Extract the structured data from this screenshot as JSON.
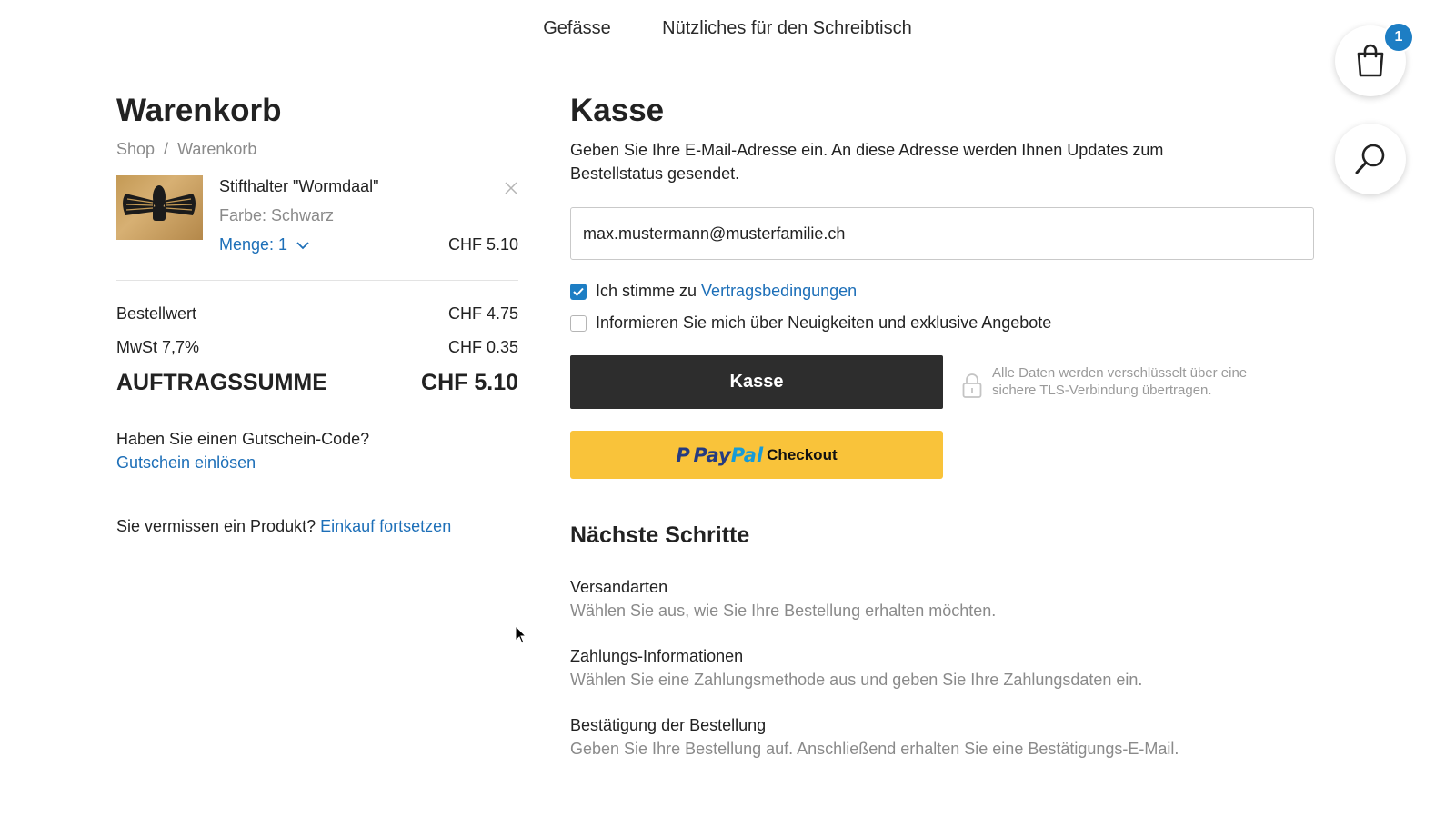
{
  "nav": {
    "items": [
      "Gefässe",
      "Nützliches für den Schreibtisch"
    ]
  },
  "cart_badge": "1",
  "cart": {
    "title": "Warenkorb",
    "breadcrumb": [
      "Shop",
      "Warenkorb"
    ],
    "breadcrumb_sep": "/",
    "item": {
      "name": "Stifthalter \"Wormdaal\"",
      "color": "Farbe: Schwarz",
      "quantity": "Menge: 1",
      "price": "CHF 5.10"
    },
    "summary": [
      {
        "label": "Bestellwert",
        "value": "CHF 4.75"
      },
      {
        "label": "MwSt 7,7%",
        "value": "CHF 0.35"
      }
    ],
    "total": {
      "label": "AUFTRAGSSUMME",
      "value": "CHF 5.10"
    },
    "coupon_question": "Haben Sie einen Gutschein-Code?",
    "coupon_link": "Gutschein einlösen",
    "missing_text": "Sie vermissen ein Produkt?",
    "missing_link": "Einkauf fortsetzen"
  },
  "checkout": {
    "title": "Kasse",
    "intro": "Geben Sie Ihre E-Mail-Adresse ein. An diese Adresse werden Ihnen Updates zum Bestellstatus gesendet.",
    "email_value": "max.mustermann@musterfamilie.ch",
    "terms_prefix": "Ich stimme zu",
    "terms_link": "Vertragsbedingungen",
    "terms_checked": true,
    "newsletter_label": "Informieren Sie mich über Neuigkeiten und exklusive Angebote",
    "newsletter_checked": false,
    "kasse_button": "Kasse",
    "secure_text": "Alle Daten werden verschlüsselt über eine sichere TLS-Verbindung übertragen.",
    "paypal": {
      "pay": "Pay",
      "pal": "Pal",
      "checkout": "Checkout"
    },
    "next_title": "Nächste Schritte",
    "steps": [
      {
        "title": "Versandarten",
        "desc": "Wählen Sie aus, wie Sie Ihre Bestellung erhalten möchten."
      },
      {
        "title": "Zahlungs-Informationen",
        "desc": "Wählen Sie eine Zahlungsmethode aus und geben Sie Ihre Zahlungsdaten ein."
      },
      {
        "title": "Bestätigung der Bestellung",
        "desc": "Geben Sie Ihre Bestellung auf. Anschließend erhalten Sie eine Bestätigungs-E-Mail."
      }
    ]
  },
  "colors": {
    "link": "#1d6fb8",
    "accent": "#1d7ec4",
    "dark_button": "#2d2d2d",
    "paypal_yellow": "#f9c33a"
  }
}
